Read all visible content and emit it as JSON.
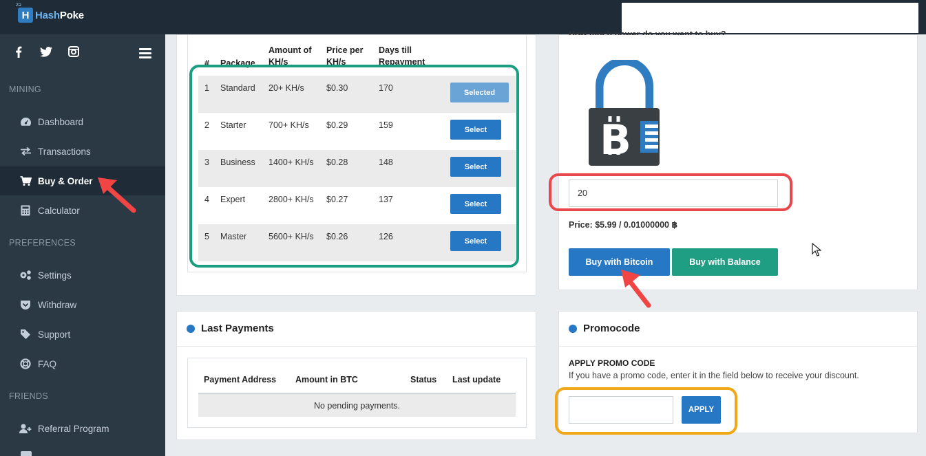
{
  "brand": {
    "prefix": "Hash",
    "suffix": "Poke",
    "mark": "H",
    "mark_tiny": "2ǝ"
  },
  "social": {
    "facebook": "f",
    "twitter": "t",
    "instagram": "◎"
  },
  "icons": {
    "facebook": "facebook-icon",
    "twitter": "twitter-icon",
    "instagram": "instagram-icon",
    "menu": "hamburger-menu-icon",
    "dashboard": "dashboard-gauge-icon",
    "transactions": "arrows-exchange-icon",
    "buy": "shopping-cart-icon",
    "calculator": "calculator-icon",
    "settings": "gears-icon",
    "withdraw": "pocket-shield-icon",
    "support": "tag-icon",
    "faq": "life-ring-icon",
    "referral": "user-plus-icon",
    "bitcoin": "bitcoin-lock-icon"
  },
  "sidebar": {
    "sections": [
      {
        "title": "MINING",
        "items": [
          {
            "label": "Dashboard"
          },
          {
            "label": "Transactions"
          },
          {
            "label": "Buy & Order",
            "active": true
          },
          {
            "label": "Calculator"
          }
        ]
      },
      {
        "title": "PREFERENCES",
        "items": [
          {
            "label": "Settings"
          },
          {
            "label": "Withdraw"
          },
          {
            "label": "Support"
          },
          {
            "label": "FAQ"
          }
        ]
      },
      {
        "title": "FRIENDS",
        "items": [
          {
            "label": "Referral Program"
          }
        ]
      }
    ]
  },
  "packages": {
    "headers": {
      "num": "#",
      "package": "Package",
      "amount_l1": "Amount of",
      "amount_l2": "KH/s",
      "price_l1": "Price per",
      "price_l2": "KH/s",
      "days_l1": "Days till",
      "days_l2": "Repayment"
    },
    "rows": [
      {
        "num": "1",
        "name": "Standard",
        "amount": "20+ KH/s",
        "price": "$0.30",
        "days": "170",
        "button": "Selected"
      },
      {
        "num": "2",
        "name": "Starter",
        "amount": "700+ KH/s",
        "price": "$0.29",
        "days": "159",
        "button": "Select"
      },
      {
        "num": "3",
        "name": "Business",
        "amount": "1400+ KH/s",
        "price": "$0.28",
        "days": "148",
        "button": "Select"
      },
      {
        "num": "4",
        "name": "Expert",
        "amount": "2800+ KH/s",
        "price": "$0.27",
        "days": "137",
        "button": "Select"
      },
      {
        "num": "5",
        "name": "Master",
        "amount": "5600+ KH/s",
        "price": "$0.26",
        "days": "126",
        "button": "Select"
      }
    ]
  },
  "last_payments": {
    "title": "Last Payments",
    "headers": {
      "address": "Payment Address",
      "amount": "Amount in BTC",
      "status": "Status",
      "updated": "Last update"
    },
    "empty": "No pending payments."
  },
  "buy": {
    "question": "How much power do you want to buy?",
    "amount_value": "20",
    "price_label": "Price:",
    "price_value": "$5.99 / 0.01000000 ฿",
    "buy_bitcoin": "Buy with Bitcoin",
    "buy_balance": "Buy with Balance"
  },
  "promo": {
    "title": "Promocode",
    "heading": "APPLY PROMO CODE",
    "description": "If you have a promo code, enter it in the field below to receive your discount.",
    "input_value": "",
    "apply": "APPLY"
  },
  "colors": {
    "sidebar": "#2b3945",
    "topbar": "#1f2b36",
    "primary": "#2778c4",
    "success": "#1f9e84",
    "highlight_green": "#1a9e82",
    "highlight_red": "#e8474b",
    "highlight_orange": "#f0a818",
    "arrow_red": "#f04545"
  }
}
